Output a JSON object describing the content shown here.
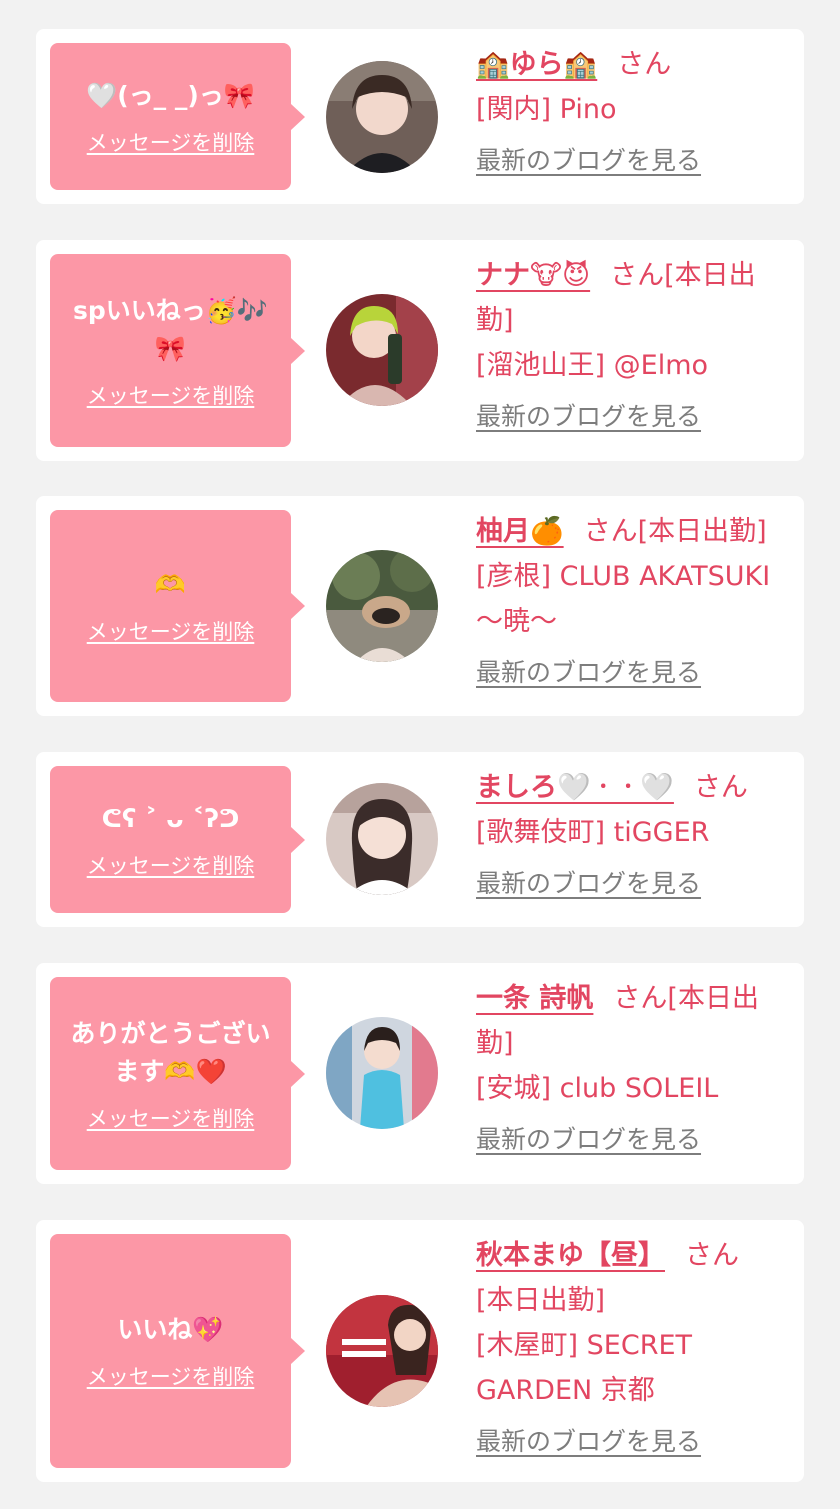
{
  "colors": {
    "background": "#f2f2f2",
    "card": "#ffffff",
    "bubble": "#fc97a6",
    "accent": "#e24661",
    "muted": "#7d7d7d"
  },
  "delete_label": "メッセージを削除",
  "blog_label": "最新のブログを見る",
  "san_suffix": "さん",
  "messages": [
    {
      "message": "🤍(っ_ _)っ🎀",
      "name": "🏫ゆら🏫",
      "status": "",
      "shop": "[関内] Pino"
    },
    {
      "message": "spいいねっ🥳🎶🎀",
      "name": "ナナ🐮😈",
      "status": "[本日出勤]",
      "shop": "[溜池山王] @Elmo"
    },
    {
      "message": "🫶",
      "name": "柚月🍊",
      "status": "[本日出勤]",
      "shop": "[彦根] CLUB AKATSUKI 〜暁〜"
    },
    {
      "message": "ᕦ⁠ʕ⁠ ⁠˃⁠ ⁠ᴗ ⁠˂⁠ʔ⁠ᕤ",
      "name": "ましろ🤍ㆍㆍ🤍",
      "status": "",
      "shop": "[歌舞伎町] tiGGER"
    },
    {
      "message": "ありがとうございます🫶❤️",
      "name": "一条 詩帆",
      "status": "[本日出勤]",
      "shop": "[安城] club SOLEIL"
    },
    {
      "message": "いいね💖",
      "name": "秋本まゆ【昼】",
      "status": "[本日出勤]",
      "shop": "[木屋町] SECRET GARDEN 京都"
    }
  ]
}
